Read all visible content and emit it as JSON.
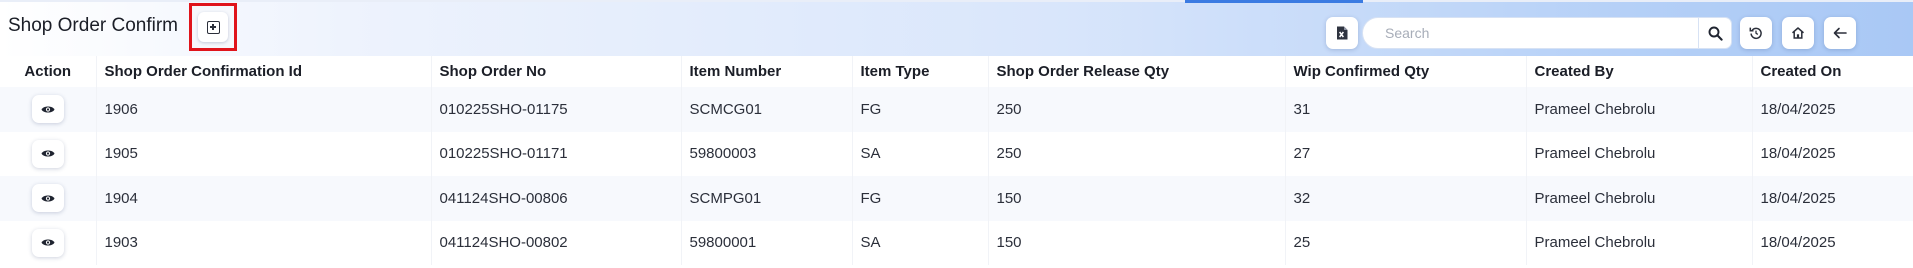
{
  "header": {
    "title": "Shop Order Confirm",
    "add_icon": "square-plus-icon",
    "toolbar": {
      "excel_icon": "excel-export-icon",
      "search_placeholder": "Search",
      "search_value": "",
      "search_icon": "search-icon",
      "refresh_icon": "refresh-icon",
      "home_icon": "home-icon",
      "back_icon": "arrow-left-icon"
    }
  },
  "table": {
    "columns": [
      "Action",
      "Shop Order Confirmation Id",
      "Shop Order No",
      "Item Number",
      "Item Type",
      "Shop Order Release Qty",
      "Wip Confirmed Qty",
      "Created By",
      "Created On"
    ],
    "action_icon": "eye-icon",
    "rows": [
      {
        "id": "1906",
        "shop_order_no": "010225SHO-01175",
        "item_number": "SCMCG01",
        "item_type": "FG",
        "release_qty": "250",
        "wip_confirmed_qty": "31",
        "created_by": "Prameel Chebrolu",
        "created_on": "18/04/2025"
      },
      {
        "id": "1905",
        "shop_order_no": "010225SHO-01171",
        "item_number": "59800003",
        "item_type": "SA",
        "release_qty": "250",
        "wip_confirmed_qty": "27",
        "created_by": "Prameel Chebrolu",
        "created_on": "18/04/2025"
      },
      {
        "id": "1904",
        "shop_order_no": "041124SHO-00806",
        "item_number": "SCMPG01",
        "item_type": "FG",
        "release_qty": "150",
        "wip_confirmed_qty": "32",
        "created_by": "Prameel Chebrolu",
        "created_on": "18/04/2025"
      },
      {
        "id": "1903",
        "shop_order_no": "041124SHO-00802",
        "item_number": "59800001",
        "item_type": "SA",
        "release_qty": "150",
        "wip_confirmed_qty": "25",
        "created_by": "Prameel Chebrolu",
        "created_on": "18/04/2025"
      }
    ]
  },
  "colors": {
    "highlight_border": "#e0141b",
    "header_gradient_end": "#a9c8f5",
    "tab_accent": "#3b7be2",
    "row_stripe": "#f7f9fd"
  }
}
